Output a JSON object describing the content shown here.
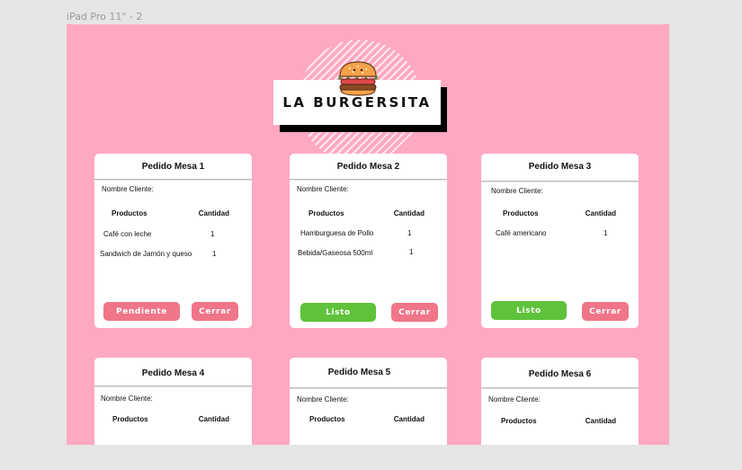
{
  "frame": {
    "label": "iPad Pro 11\" - 2"
  },
  "brand": {
    "name": "LA BURGERSITA",
    "icon": "burger-icon"
  },
  "labels": {
    "client": "Nombre Cliente:",
    "products": "Productos",
    "quantity": "Cantidad"
  },
  "colors": {
    "background": "#ffa8c2",
    "pink_button": "#f07588",
    "green_button": "#5ec23a"
  },
  "orders": [
    {
      "title": "Pedido Mesa 1",
      "items": [
        {
          "name": "Café con leche",
          "qty": "1"
        },
        {
          "name": "Sandwich de Jamón y queso",
          "qty": "1"
        }
      ],
      "status_label": "Pendiente",
      "close_label": "Cerrar"
    },
    {
      "title": "Pedido Mesa 2",
      "items": [
        {
          "name": "Hamburguesa de Pollo",
          "qty": "1"
        },
        {
          "name": "Bebida/Gaseosa 500ml",
          "qty": "1"
        }
      ],
      "status_label": "Listo",
      "close_label": "Cerrar"
    },
    {
      "title": "Pedido Mesa 3",
      "items": [
        {
          "name": "Café  americano",
          "qty": "1"
        }
      ],
      "status_label": "Listo",
      "close_label": "Cerrar"
    },
    {
      "title": "Pedido Mesa 4"
    },
    {
      "title": "Pedido Mesa 5"
    },
    {
      "title": "Pedido Mesa 6"
    }
  ]
}
